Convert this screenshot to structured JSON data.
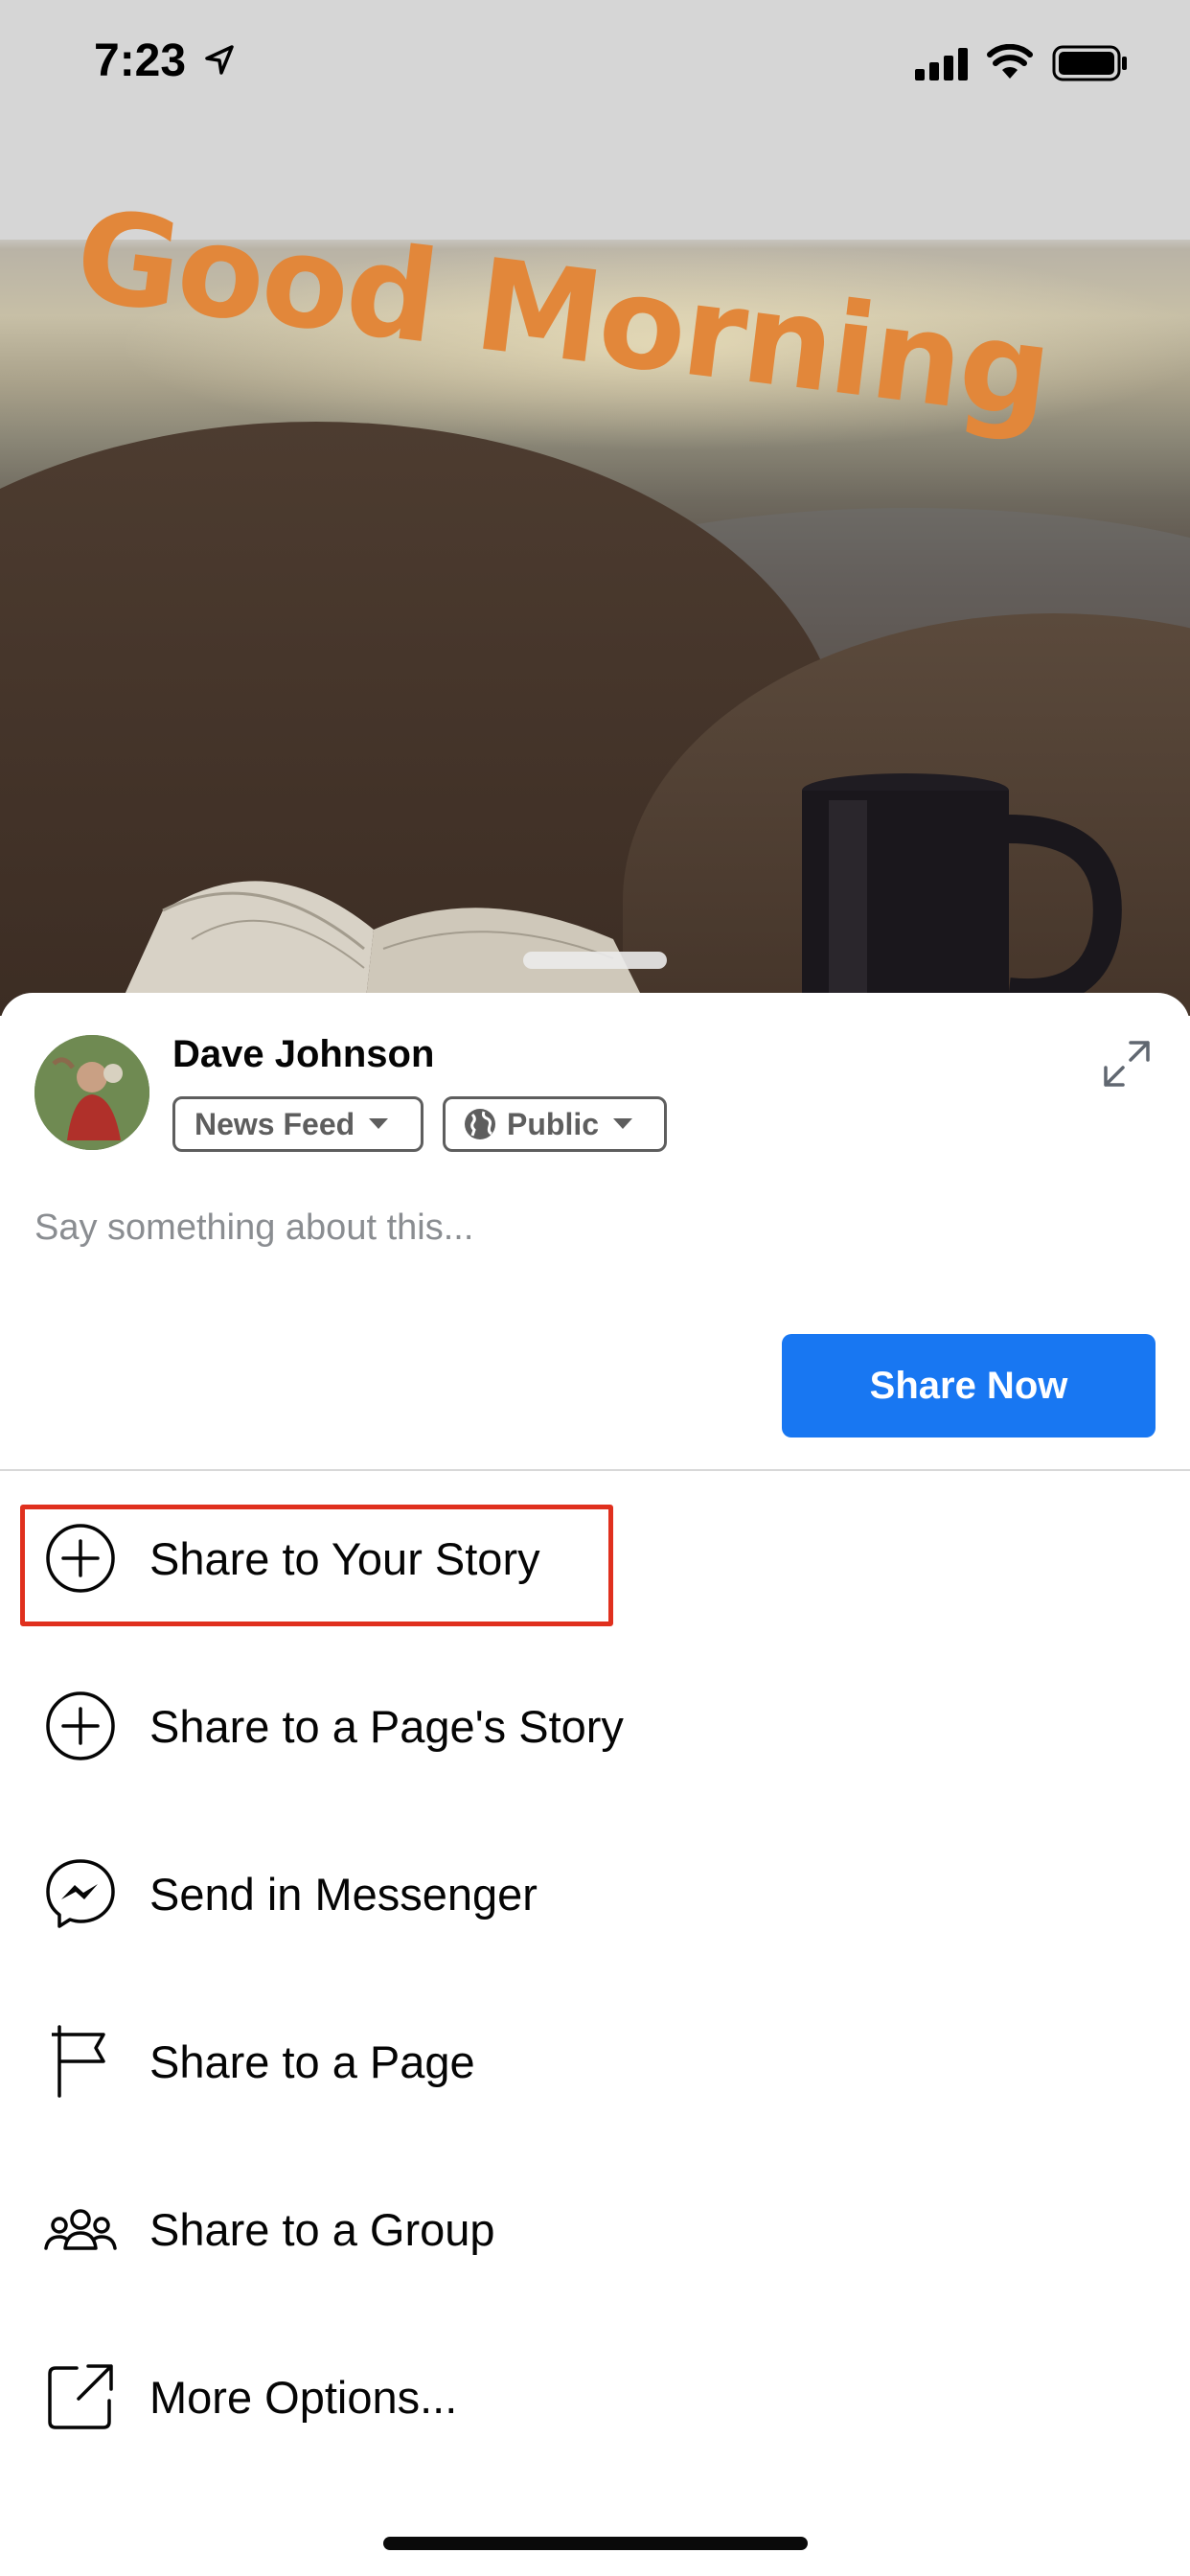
{
  "status_bar": {
    "time": "7:23",
    "icons": [
      "location-arrow-icon",
      "signal-icon",
      "wifi-icon",
      "battery-icon"
    ]
  },
  "background_image": {
    "headline": "Good Morning",
    "headline_color": "#e2873a"
  },
  "composer": {
    "user_name": "Dave Johnson",
    "audience_feed_label": "News Feed",
    "audience_privacy_label": "Public",
    "placeholder": "Say something about this...",
    "share_now_label": "Share Now",
    "share_now_color": "#1877f2"
  },
  "options": [
    {
      "label": "Share to Your Story",
      "icon": "plus-circle-icon",
      "highlighted": true
    },
    {
      "label": "Share to a Page's Story",
      "icon": "plus-circle-icon"
    },
    {
      "label": "Send in Messenger",
      "icon": "messenger-icon"
    },
    {
      "label": "Share to a Page",
      "icon": "flag-icon"
    },
    {
      "label": "Share to a Group",
      "icon": "group-icon"
    },
    {
      "label": "More Options...",
      "icon": "external-share-icon"
    }
  ],
  "highlight_color": "#e0301e"
}
